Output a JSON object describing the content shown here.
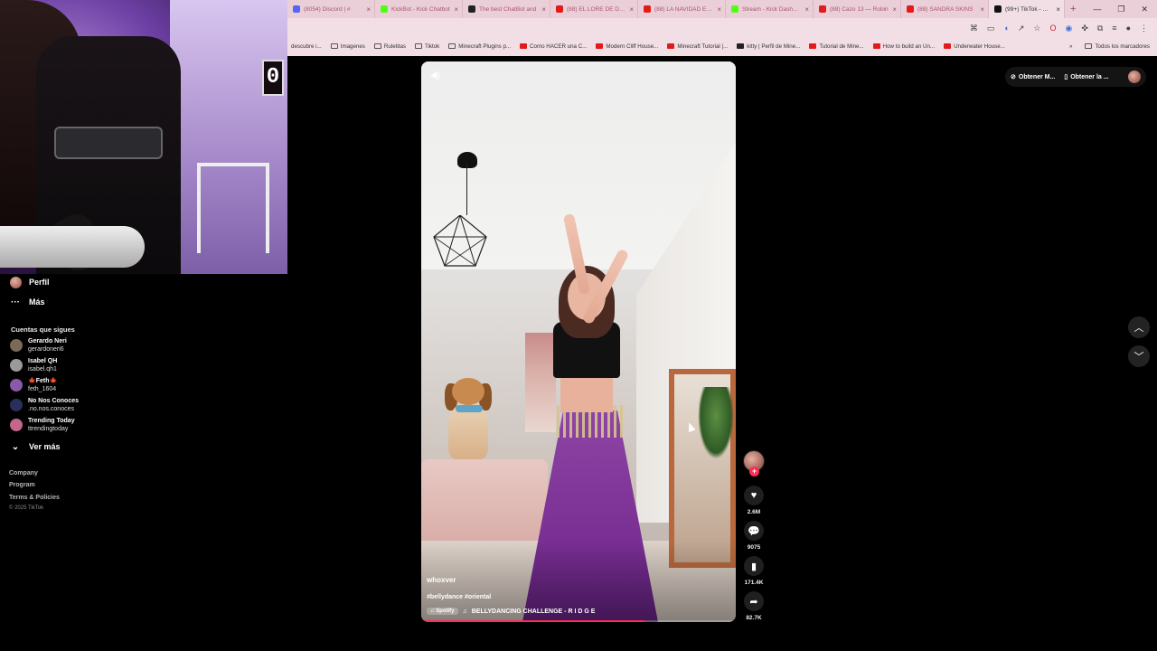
{
  "browser": {
    "tabs": [
      {
        "title": "(8054) Discord | #",
        "fav_color": "#5865f2"
      },
      {
        "title": "KickBot - Kick Chatbot",
        "fav_color": "#53fc18"
      },
      {
        "title": "The best ChatBot and",
        "fav_color": "#222222"
      },
      {
        "title": "(88) EL LORE DE DARK",
        "fav_color": "#e21a1a"
      },
      {
        "title": "(88) LA NAVIDAD ELIT",
        "fav_color": "#e21a1a"
      },
      {
        "title": "Stream - Kick Dashboard",
        "fav_color": "#53fc18"
      },
      {
        "title": "(88) Cazo 13 — Robin",
        "fav_color": "#e21a1a"
      },
      {
        "title": "(88) SANDRA SKINS",
        "fav_color": "#e21a1a"
      },
      {
        "title": "(99+) TikTok - Make",
        "fav_color": "#111111",
        "active": true
      }
    ],
    "bookmarks": [
      {
        "label": "descubre i...",
        "kind": "plain"
      },
      {
        "label": "Imagenes",
        "kind": "folder"
      },
      {
        "label": "Ruletitas",
        "kind": "folder"
      },
      {
        "label": "Tiktok",
        "kind": "folder"
      },
      {
        "label": "Minecraft Plugins p...",
        "kind": "folder"
      },
      {
        "label": "Como HACER una C...",
        "kind": "yt"
      },
      {
        "label": "Modern Cliff House...",
        "kind": "yt"
      },
      {
        "label": "Minecraft Tutorial |...",
        "kind": "yt"
      },
      {
        "label": "kitty | Perfil de Mine...",
        "kind": "kk"
      },
      {
        "label": "Tutorial de Mine...",
        "kind": "yt"
      },
      {
        "label": "How to build an Un...",
        "kind": "yt"
      },
      {
        "label": "Underwater House...",
        "kind": "yt"
      }
    ],
    "all_bookmarks": "Todos los marcadores"
  },
  "webcam": {
    "clock_digit": "0"
  },
  "sidebar": {
    "profile_label": "Perfil",
    "more_label": "Más",
    "following_title": "Cuentas que sigues",
    "accounts": [
      {
        "name": "Gerardo Neri",
        "handle": "gerardoneri6",
        "color": "#7a6a58"
      },
      {
        "name": "Isabel QH",
        "handle": "isabel.qh1",
        "color": "#9a9a9a"
      },
      {
        "name": "🍁Feth🍁",
        "handle": "feth_1604",
        "color": "#8a5aa8"
      },
      {
        "name": "No Nos Conoces",
        "handle": ".no.nos.conoces",
        "color": "#2a2e5a"
      },
      {
        "name": "Trending Today",
        "handle": "ttrendingtoday",
        "color": "#c2668a"
      }
    ],
    "see_more": "Ver más",
    "footer": [
      "Company",
      "Program",
      "Terms & Policies"
    ],
    "copyright": "© 2025 TikTok"
  },
  "video": {
    "author": "whoxver",
    "hashtags": "#bellydance #oriental",
    "music_source": "♫ Spotify",
    "music_title": "BELLYDANCING CHALLENGE - R I D G E",
    "progress": 0.71
  },
  "actions": {
    "likes": "2.6M",
    "comments": "9075",
    "saves": "171.4K",
    "shares": "82.7K"
  },
  "top_right": {
    "btn1": "Obtener M...",
    "btn2": "Obtener la ..."
  }
}
